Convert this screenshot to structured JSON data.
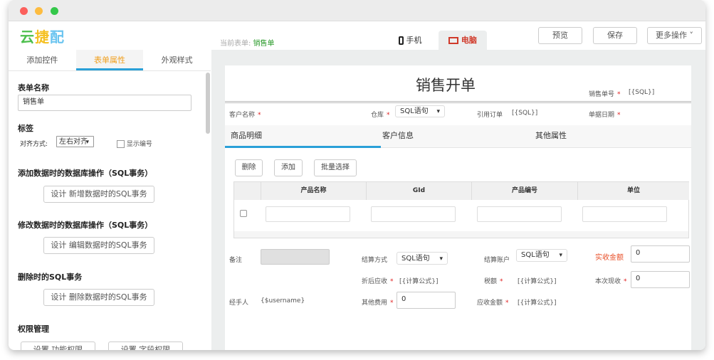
{
  "app": {
    "logo": "云捷配",
    "current_form_label": "当前表单:",
    "current_form": "销售单"
  },
  "views": {
    "mobile": "手机",
    "desktop": "电脑"
  },
  "toolbar": {
    "preview": "预览",
    "save": "保存",
    "more": "更多操作"
  },
  "left_tabs": [
    "添加控件",
    "表单属性",
    "外观样式"
  ],
  "props": {
    "form_name_heading": "表单名称",
    "form_name_value": "销售单",
    "label_heading": "标签",
    "align_label": "对齐方式:",
    "align_value": "左右对齐",
    "show_number": "显示编号",
    "add_sql_heading": "添加数据时的数据库操作（SQL事务）",
    "add_sql_button": "设计 新增数据时的SQL事务",
    "edit_sql_heading": "修改数据时的数据库操作（SQL事务）",
    "edit_sql_button": "设计 编辑数据时的SQL事务",
    "del_sql_heading": "删除时的SQL事务",
    "del_sql_button": "设计 删除数据时的SQL事务",
    "perm_heading": "权限管理",
    "perm_btn1": "设置 功能权限",
    "perm_btn2": "设置 字段权限"
  },
  "form": {
    "title": "销售开单",
    "order_no_label": "销售单号",
    "order_no_value": "[{SQL}]",
    "customer_label": "客户名称",
    "warehouse_label": "仓库",
    "warehouse_value": "SQL语句",
    "ref_order_label": "引用订单",
    "ref_order_value": "[{SQL}]",
    "date_label": "单据日期",
    "tabs": [
      "商品明细",
      "客户信息",
      "其他属性"
    ],
    "actions": [
      "删除",
      "添加",
      "批量选择"
    ],
    "columns": [
      "产品名称",
      "GId",
      "产品编号",
      "单位"
    ],
    "remark_label": "备注",
    "settle_method_label": "结算方式",
    "settle_method_value": "SQL语句",
    "settle_account_label": "结算账户",
    "settle_account_value": "SQL语句",
    "actual_label": "实收金额",
    "actual_value": "0",
    "discount_label": "折后应收",
    "discount_value": "[{计算公式}]",
    "tax_label": "税额",
    "tax_value": "[{计算公式}]",
    "cash_label": "本次现收",
    "cash_value": "0",
    "handler_label": "经手人",
    "handler_value": "{$username}",
    "other_fee_label": "其他费用",
    "other_fee_value": "0",
    "receivable_label": "应收金额",
    "receivable_value": "[{计算公式}]"
  }
}
